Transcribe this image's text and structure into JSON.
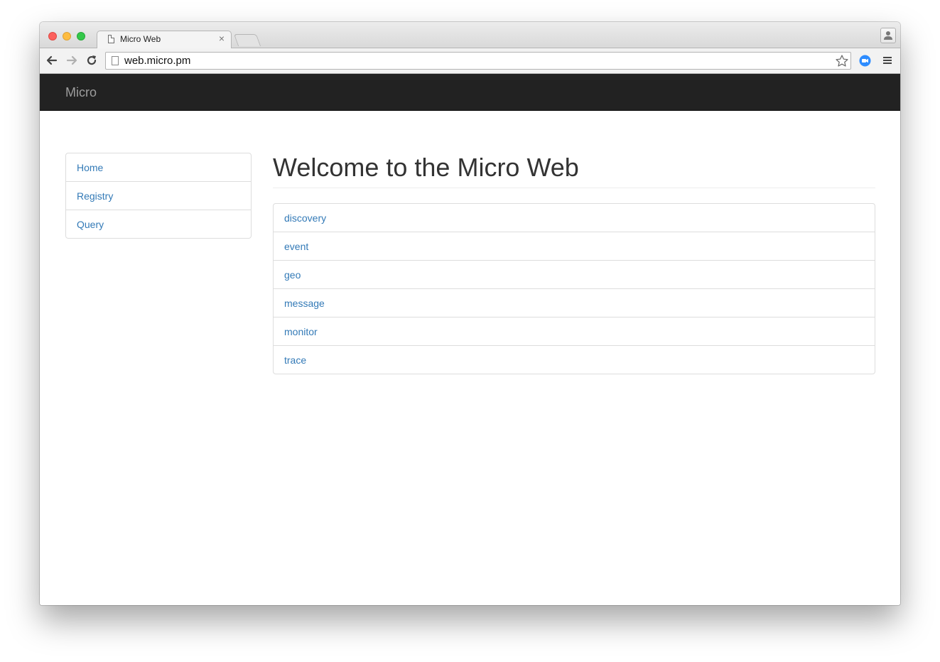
{
  "browser": {
    "tab": {
      "title": "Micro Web",
      "close_glyph": "×"
    },
    "address_bar": {
      "url": "web.micro.pm"
    },
    "icons": {
      "back": "back-arrow-icon",
      "forward": "forward-arrow-icon",
      "reload": "reload-icon",
      "bookmark": "star-icon",
      "extension": "video-camera-icon",
      "menu": "hamburger-menu-icon",
      "profile": "person-icon"
    }
  },
  "navbar": {
    "brand": "Micro",
    "background": "#222222",
    "brand_color": "#9d9d9d"
  },
  "sidebar": {
    "items": [
      {
        "label": "Home"
      },
      {
        "label": "Registry"
      },
      {
        "label": "Query"
      }
    ]
  },
  "main": {
    "title": "Welcome to the Micro Web",
    "services": [
      {
        "label": "discovery"
      },
      {
        "label": "event"
      },
      {
        "label": "geo"
      },
      {
        "label": "message"
      },
      {
        "label": "monitor"
      },
      {
        "label": "trace"
      }
    ]
  },
  "colors": {
    "link": "#337ab7",
    "heading": "#333333",
    "border": "#dddddd"
  }
}
